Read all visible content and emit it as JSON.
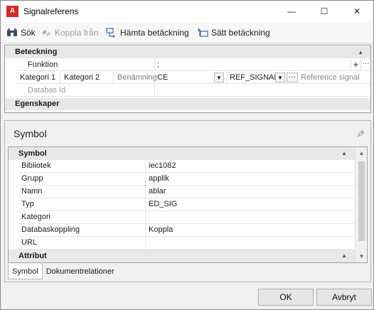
{
  "window": {
    "title": "Signalreferens",
    "controls": {
      "minimize": "—",
      "maximize": "☐",
      "close": "✕"
    }
  },
  "toolbar": {
    "search_label": "Sök",
    "disconnect_label": "Koppla från",
    "fetch_label": "Hämta betäckning",
    "set_label": "Sätt betäckning"
  },
  "designation_grid": {
    "category_beteckning": "Beteckning",
    "funktion_label": "Funktion",
    "funktion_value": ";",
    "kategori1_label": "Kategori 1",
    "kategori2_label": "Kategori 2",
    "benamning_label": "Benämning",
    "kategori1_value": "CE",
    "kategori2_value": "REF_SIGNAL",
    "benamning_value": "Reference signal",
    "databas_label": "Databas Id",
    "databas_value": "",
    "category_egenskaper": "Egenskaper"
  },
  "symbol_panel": {
    "title": "Symbol",
    "category_symbol": "Symbol",
    "rows": [
      {
        "name": "Bibliotek",
        "value": "iec1082"
      },
      {
        "name": "Grupp",
        "value": "applik"
      },
      {
        "name": "Namn",
        "value": "ablar"
      },
      {
        "name": "Typ",
        "value": "ED_SIG"
      },
      {
        "name": "Kategori",
        "value": ""
      },
      {
        "name": "Databaskoppling",
        "value": "Koppla"
      },
      {
        "name": "URL",
        "value": ""
      }
    ],
    "category_attribut": "Attribut",
    "tabs": [
      "Symbol",
      "Dokumentrelationer"
    ]
  },
  "footer": {
    "ok_label": "OK",
    "cancel_label": "Avbryt"
  },
  "colors": {
    "app_icon": "#d42a1f",
    "category_bg": "#e8e8e8",
    "grid_line": "#e2e2e2"
  }
}
